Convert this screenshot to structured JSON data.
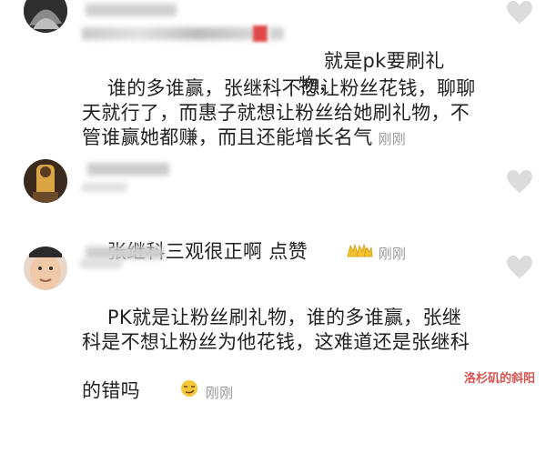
{
  "comments": [
    {
      "text_line1": "就是pk要刷礼物，",
      "text_rest": "谁的多谁赢，张继科不想让粉丝花钱，聊聊天就行了，而惠子就想让粉丝给她刷礼物，不管谁赢她都赚，而且还能增长名气",
      "time": "刚刚"
    },
    {
      "text": "张继科三观很正啊 点赞",
      "emoji": "clap-hands-emoji",
      "time": "刚刚"
    },
    {
      "text": "PK就是让粉丝刷礼物，谁的多谁赢，张继科是不想让粉丝为他花钱，这难道还是张继科的错吗",
      "emoji": "smirk-face-emoji",
      "time": "刚刚"
    }
  ],
  "watermark": "洛杉矶的斜阳",
  "colors": {
    "text": "#222222",
    "time": "#9a9a9a",
    "heart": "#dcdcdc",
    "watermark": "#d9534f"
  }
}
